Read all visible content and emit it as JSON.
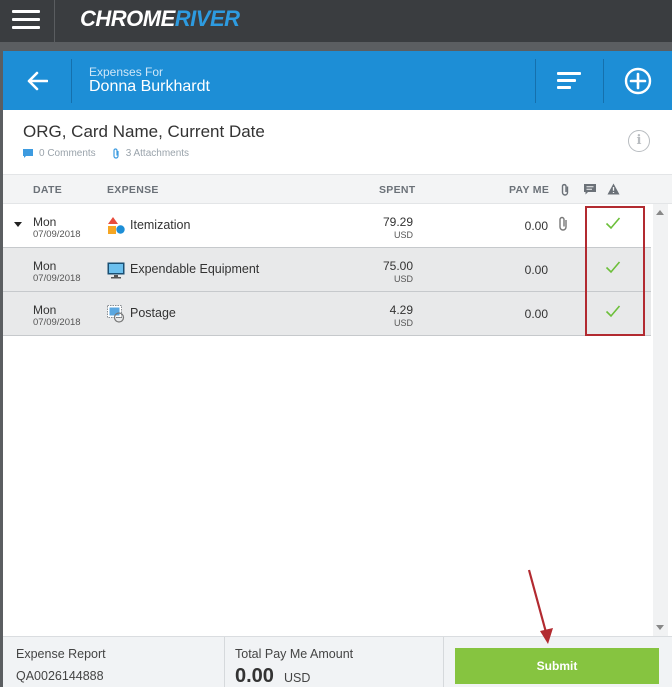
{
  "app": {
    "logo_part1": "CHROME",
    "logo_part2": "RIVER",
    "menu_icon": "hamburger-icon"
  },
  "header": {
    "subtitle": "Expenses For",
    "name": "Donna Burkhardt",
    "back_icon": "arrow-left-icon",
    "sort_icon": "sort-icon",
    "add_icon": "plus-circle-icon"
  },
  "report": {
    "title": "ORG, Card Name, Current Date",
    "comments": "0 Comments",
    "attachments": "3 Attachments",
    "info_icon_text": "i"
  },
  "columns": {
    "date": "DATE",
    "expense": "EXPENSE",
    "spent": "SPENT",
    "payme": "PAY ME"
  },
  "rows": [
    {
      "day": "Mon",
      "date": "07/09/2018",
      "name": "Itemization",
      "spent": "79.29",
      "currency": "USD",
      "payme": "0.00",
      "icon": "itemization-icon",
      "has_attachment": true,
      "status": "check-icon"
    },
    {
      "day": "Mon",
      "date": "07/09/2018",
      "name": "Expendable Equipment",
      "spent": "75.00",
      "currency": "USD",
      "payme": "0.00",
      "icon": "monitor-icon",
      "has_attachment": false,
      "status": "check-icon"
    },
    {
      "day": "Mon",
      "date": "07/09/2018",
      "name": "Postage",
      "spent": "4.29",
      "currency": "USD",
      "payme": "0.00",
      "icon": "postage-icon",
      "has_attachment": false,
      "status": "check-icon"
    }
  ],
  "footer": {
    "report_label": "Expense Report",
    "report_id": "QA0026144888",
    "total_label": "Total Pay Me Amount",
    "total_value": "0.00",
    "total_currency": "USD",
    "submit_label": "Submit"
  },
  "colors": {
    "topbar": "#3a3d40",
    "header_blue": "#1d8ed6",
    "submit_green": "#86c440",
    "check_green": "#6cbf3a",
    "annotation_red": "#b22a30"
  }
}
